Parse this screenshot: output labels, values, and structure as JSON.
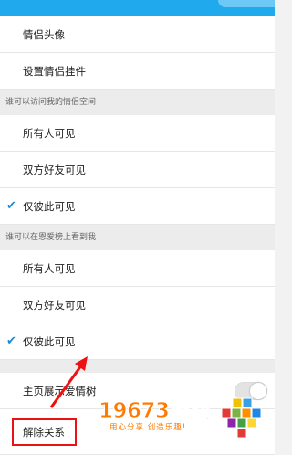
{
  "rows_top": [
    {
      "label": "情侣头像"
    },
    {
      "label": "设置情侣挂件"
    }
  ],
  "section1": {
    "header": "谁可以访问我的情侣空间",
    "options": [
      {
        "label": "所有人可见",
        "checked": false
      },
      {
        "label": "双方好友可见",
        "checked": false
      },
      {
        "label": "仅彼此可见",
        "checked": true
      }
    ]
  },
  "section2": {
    "header": "谁可以在恩爱榜上看到我",
    "options": [
      {
        "label": "所有人可见",
        "checked": false
      },
      {
        "label": "双方好友可见",
        "checked": false
      },
      {
        "label": "仅彼此可见",
        "checked": true
      }
    ]
  },
  "homepage_tree": {
    "label": "主页展示爱情树",
    "enabled": false
  },
  "unlink": {
    "label": "解除关系"
  },
  "check_icon": "✔",
  "watermark": {
    "title": "19673游戏",
    "subtitle": "用心分享 创造乐趣!"
  },
  "colors": {
    "accent": "#1e88d2",
    "topbar": "#21a9ee",
    "highlight": "#ee1111",
    "watermark": "#ff7a00"
  }
}
